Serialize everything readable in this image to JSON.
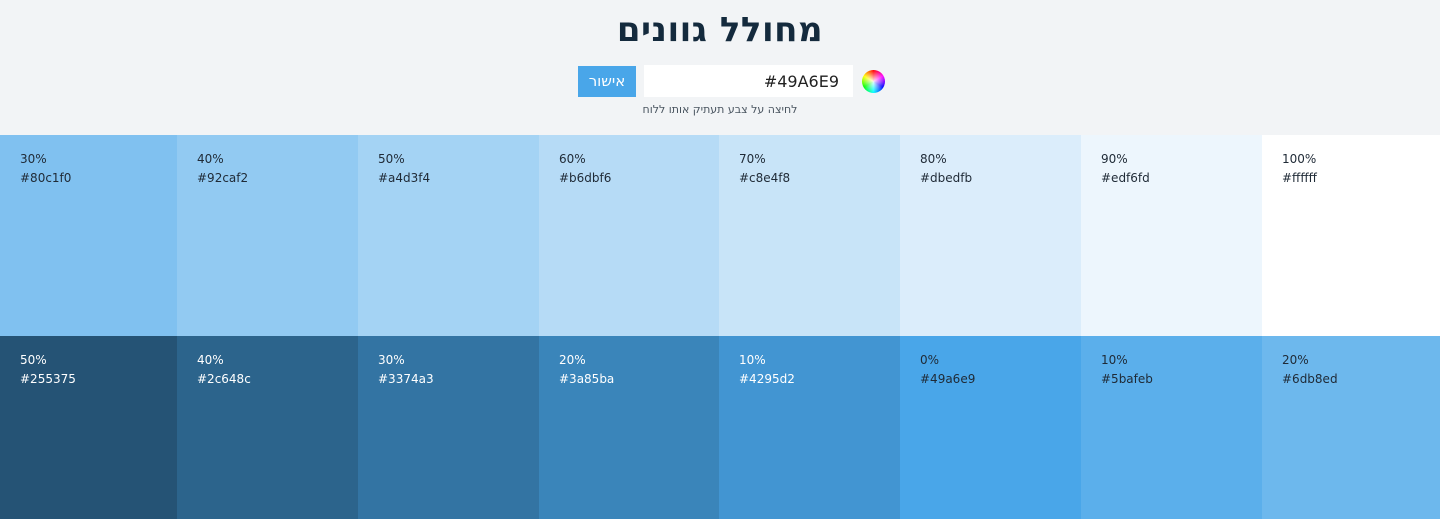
{
  "header": {
    "title": "מחולל גוונים",
    "confirm_label": "אישור",
    "color_value": "#49A6E9",
    "hint": "לחיצה על צבע תעתיק אותו ללוח",
    "picker_icon": "color-wheel-icon"
  },
  "colors": {
    "accent": "#49a6e9",
    "background": "#f2f4f6",
    "title": "#142a3d"
  },
  "tints": [
    {
      "percent": "30%",
      "hex": "#80c1f0"
    },
    {
      "percent": "40%",
      "hex": "#92caf2"
    },
    {
      "percent": "50%",
      "hex": "#a4d3f4"
    },
    {
      "percent": "60%",
      "hex": "#b6dbf6"
    },
    {
      "percent": "70%",
      "hex": "#c8e4f8"
    },
    {
      "percent": "80%",
      "hex": "#dbedfb"
    },
    {
      "percent": "90%",
      "hex": "#edf6fd"
    },
    {
      "percent": "100%",
      "hex": "#ffffff"
    }
  ],
  "shades": [
    {
      "percent": "50%",
      "hex": "#255375"
    },
    {
      "percent": "40%",
      "hex": "#2c648c"
    },
    {
      "percent": "30%",
      "hex": "#3374a3"
    },
    {
      "percent": "20%",
      "hex": "#3a85ba"
    },
    {
      "percent": "10%",
      "hex": "#4295d2"
    },
    {
      "percent": "0%",
      "hex": "#49a6e9"
    },
    {
      "percent": "10%",
      "hex": "#5bafeb"
    },
    {
      "percent": "20%",
      "hex": "#6db8ed"
    }
  ]
}
